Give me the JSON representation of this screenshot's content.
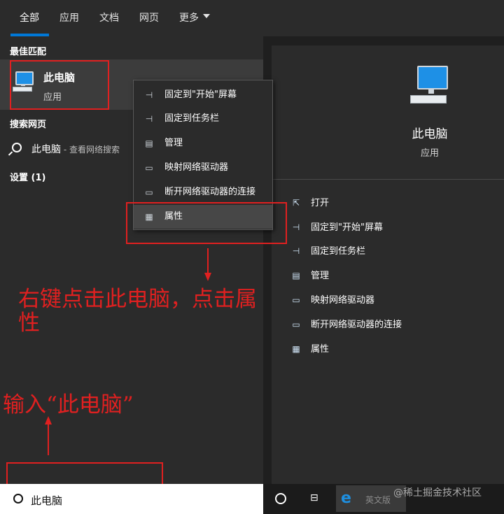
{
  "tabs": [
    {
      "label": "全部"
    },
    {
      "label": "应用"
    },
    {
      "label": "文档"
    },
    {
      "label": "网页"
    },
    {
      "label": "更多"
    }
  ],
  "left": {
    "best_match_heading": "最佳匹配",
    "best_item": {
      "title": "此电脑",
      "subtitle": "应用",
      "icon": "computer-icon"
    },
    "web_heading": "搜索网页",
    "web_item": {
      "title": "此电脑",
      "suffix": " - 查看网络搜索",
      "icon": "search-icon"
    },
    "settings_heading": "设置 (1)"
  },
  "right": {
    "title": "此电脑",
    "subtitle": "应用",
    "actions": [
      {
        "label": "打开",
        "icon": "open-icon"
      },
      {
        "label": "固定到\"开始\"屏幕",
        "icon": "pin-icon"
      },
      {
        "label": "固定到任务栏",
        "icon": "pin-icon"
      },
      {
        "label": "管理",
        "icon": "manage-icon"
      },
      {
        "label": "映射网络驱动器",
        "icon": "network-drive-icon"
      },
      {
        "label": "断开网络驱动器的连接",
        "icon": "network-drive-icon"
      },
      {
        "label": "属性",
        "icon": "properties-icon"
      }
    ]
  },
  "context_menu": {
    "items": [
      {
        "label": "固定到\"开始\"屏幕",
        "icon": "pin-icon"
      },
      {
        "label": "固定到任务栏",
        "icon": "pin-icon"
      },
      {
        "label": "管理",
        "icon": "manage-icon"
      },
      {
        "label": "映射网络驱动器",
        "icon": "network-drive-icon"
      },
      {
        "label": "断开网络驱动器的连接",
        "icon": "network-drive-icon"
      },
      {
        "label": "属性",
        "icon": "properties-icon"
      }
    ],
    "highlighted": "属性"
  },
  "annotations": {
    "right_click_line1": "右键点击此电脑，点击属",
    "right_click_line2": "性",
    "input_hint": "输入“此电脑”"
  },
  "taskbar": {
    "search_value": "此电脑",
    "ie_label": "英文版",
    "watermark": "@稀土掘金技术社区"
  },
  "colors": {
    "accent": "#0078d7",
    "annotation_red": "#e02020"
  }
}
